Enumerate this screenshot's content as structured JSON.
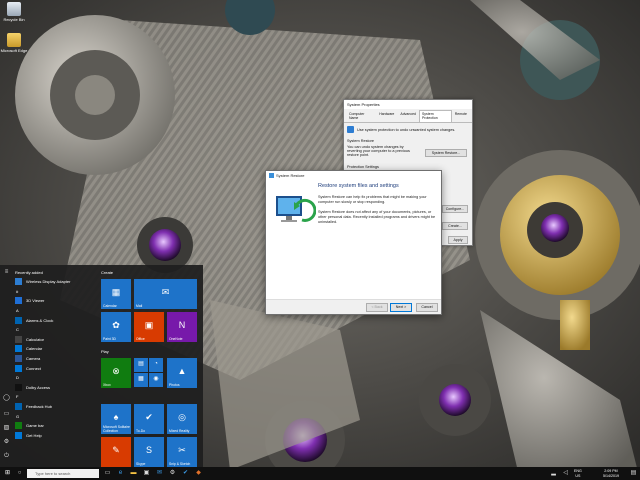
{
  "desktop": {
    "icons": [
      {
        "label": "Recycle Bin",
        "icon": "recycle-bin-icon"
      },
      {
        "label": "Microsoft Edge",
        "icon": "folder-icon"
      }
    ]
  },
  "system_properties": {
    "title": "System Properties",
    "tabs": [
      "Computer Name",
      "Hardware",
      "Advanced",
      "System Protection",
      "Remote"
    ],
    "active_tab": "System Protection",
    "intro": "Use system protection to undo unwanted system changes.",
    "restore_group": "System Restore",
    "restore_text": "You can undo system changes by reverting your computer to a previous restore point.",
    "restore_button": "System Restore...",
    "settings_group": "Protection Settings",
    "configure_button": "Configure...",
    "create_button": "Create...",
    "apply_button": "Apply"
  },
  "system_restore": {
    "title": "System Restore",
    "heading": "Restore system files and settings",
    "para1": "System Restore can help fix problems that might be making your computer run slowly or stop responding.",
    "para2": "System Restore does not affect any of your documents, pictures, or other personal data. Recently installed programs and drivers might be uninstalled.",
    "back_button": "< Back",
    "next_button": "Next >",
    "cancel_button": "Cancel"
  },
  "start_menu": {
    "recently_added_label": "Recently added",
    "apps": [
      {
        "type": "app",
        "label": "Wireless Display Adapter",
        "color": "#2d7dd2"
      },
      {
        "type": "letter",
        "label": "#"
      },
      {
        "type": "app",
        "label": "3D Viewer",
        "color": "#1f6fd6"
      },
      {
        "type": "letter",
        "label": "A"
      },
      {
        "type": "app",
        "label": "Alarms & Clock",
        "color": "#0063b1"
      },
      {
        "type": "letter",
        "label": "C"
      },
      {
        "type": "app",
        "label": "Calculator",
        "color": "#444444"
      },
      {
        "type": "app",
        "label": "Calendar",
        "color": "#0078d7"
      },
      {
        "type": "app",
        "label": "Camera",
        "color": "#2b579a"
      },
      {
        "type": "app",
        "label": "Connect",
        "color": "#0078d7"
      },
      {
        "type": "letter",
        "label": "D"
      },
      {
        "type": "app",
        "label": "Dolby Access",
        "color": "#111111"
      },
      {
        "type": "letter",
        "label": "F"
      },
      {
        "type": "app",
        "label": "Feedback Hub",
        "color": "#0063b1"
      },
      {
        "type": "letter",
        "label": "G"
      },
      {
        "type": "app",
        "label": "Game bar",
        "color": "#107c10"
      },
      {
        "type": "app",
        "label": "Get Help",
        "color": "#0078d7"
      }
    ],
    "create_label": "Create",
    "play_label": "Play",
    "tiles": [
      {
        "label": "Calendar",
        "glyph": "▦",
        "color": "#1e73c9",
        "name": "tile-calendar",
        "icon": "calendar-icon"
      },
      {
        "label": "Mail",
        "glyph": "✉",
        "color": "#1e73c9",
        "name": "tile-mail",
        "icon": "mail-icon"
      },
      {
        "label": "Paint 3D",
        "glyph": "✿",
        "color": "#1e73c9",
        "name": "tile-paint-3d",
        "icon": "paint-3d-icon"
      },
      {
        "label": "Office",
        "glyph": "▣",
        "color": "#d83b01",
        "name": "tile-office",
        "icon": "office-icon"
      },
      {
        "label": "OneNote",
        "glyph": "N",
        "color": "#7719aa",
        "name": "tile-onenote",
        "icon": "onenote-icon"
      },
      {
        "label": "Xbox",
        "glyph": "⊗",
        "color": "#107c10",
        "name": "tile-xbox",
        "icon": "xbox-icon"
      },
      {
        "label": "",
        "glyph": "▤",
        "color": "#1e73c9",
        "name": "tile-movies",
        "icon": "movies-icon"
      },
      {
        "label": "",
        "glyph": "◔",
        "color": "#1e73c9",
        "name": "tile-groove",
        "icon": "groove-icon"
      },
      {
        "label": "",
        "glyph": "▦",
        "color": "#1e73c9",
        "name": "tile-calculator",
        "icon": "calculator-icon"
      },
      {
        "label": "",
        "glyph": "◉",
        "color": "#1e73c9",
        "name": "tile-camera",
        "icon": "camera-icon"
      },
      {
        "label": "Photos",
        "glyph": "▲",
        "color": "#1e73c9",
        "name": "tile-photos",
        "icon": "photos-icon"
      },
      {
        "label": "Microsoft Solitaire Collection",
        "glyph": "♠",
        "color": "#1e73c9",
        "name": "tile-solitaire",
        "icon": "cards-icon"
      },
      {
        "label": "To-Do",
        "glyph": "✔",
        "color": "#1e73c9",
        "name": "tile-todo",
        "icon": "check-icon"
      },
      {
        "label": "Mixed Reality",
        "glyph": "◎",
        "color": "#1e73c9",
        "name": "tile-mixed-reality",
        "icon": "mixed-reality-icon"
      },
      {
        "label": "",
        "glyph": "✎",
        "color": "#d83b01",
        "name": "tile-sketch",
        "icon": "pencil-icon"
      },
      {
        "label": "Skype",
        "glyph": "S",
        "color": "#1e73c9",
        "name": "tile-skype",
        "icon": "skype-icon"
      },
      {
        "label": "Snip & Sketch",
        "glyph": "✂",
        "color": "#1e73c9",
        "name": "tile-snip-sketch",
        "icon": "scissors-icon"
      }
    ]
  },
  "taskbar": {
    "search_placeholder": "Type here to search",
    "lang": "ENG\nUS",
    "time": "2:09 PM",
    "date": "5/14/2019"
  }
}
